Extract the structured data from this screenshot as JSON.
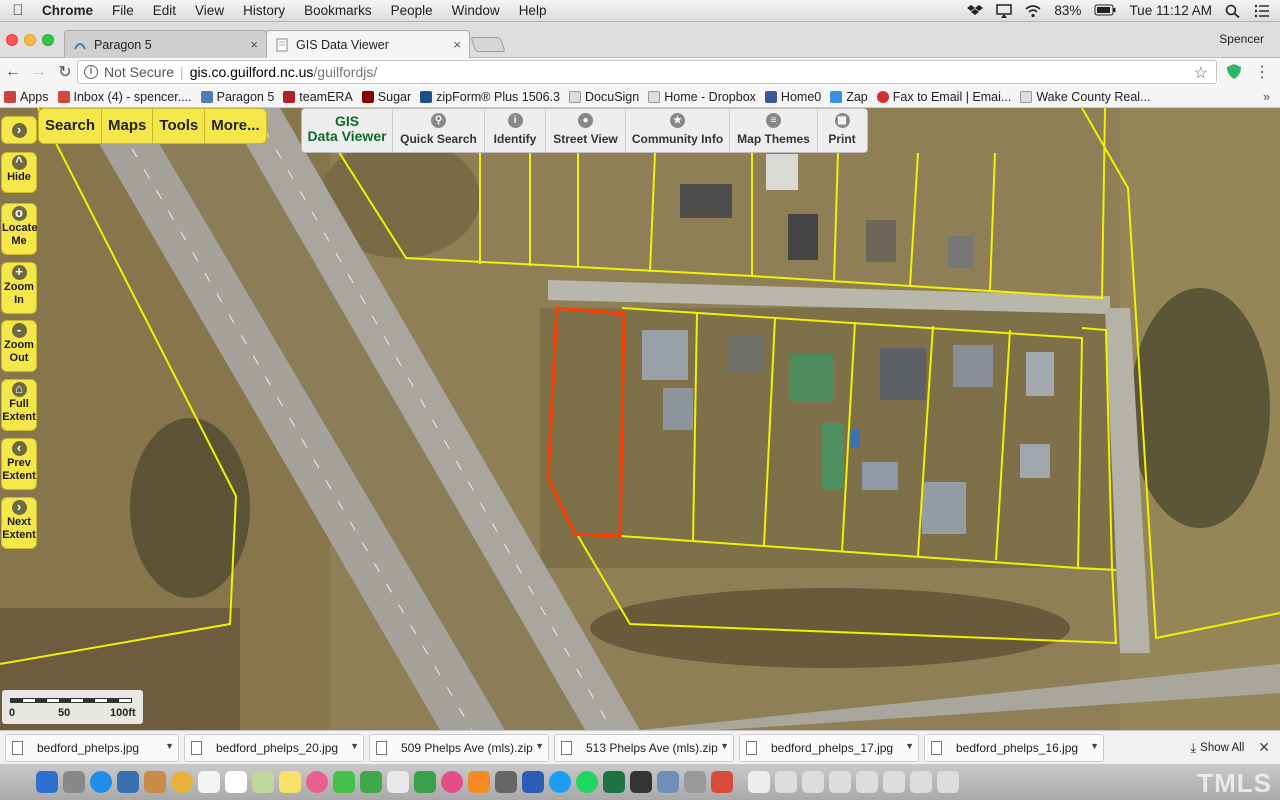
{
  "menubar": {
    "app": "Chrome",
    "menus": [
      "File",
      "Edit",
      "View",
      "History",
      "Bookmarks",
      "People",
      "Window",
      "Help"
    ],
    "battery": "83%",
    "clock": "Tue 11:12 AM"
  },
  "tabs": [
    {
      "title": "Paragon 5",
      "close": "×"
    },
    {
      "title": "GIS Data Viewer",
      "close": "×"
    }
  ],
  "profile": "Spencer",
  "address": {
    "security": "Not Secure",
    "separator": "|",
    "host": "gis.co.guilford.nc.us",
    "path": "/guilfordjs/"
  },
  "bookmarks": [
    {
      "label": "Apps",
      "color": "#d04040"
    },
    {
      "label": "Inbox (4) - spencer....",
      "color": "#d44638"
    },
    {
      "label": "Paragon 5",
      "color": "#4a7fb5"
    },
    {
      "label": "teamERA",
      "color": "#b22222"
    },
    {
      "label": "Sugar",
      "color": "#8b0000"
    },
    {
      "label": "zipForm® Plus 1506.3",
      "color": "#1a4f8a"
    },
    {
      "label": "DocuSign",
      "color": "#888888"
    },
    {
      "label": "Home - Dropbox",
      "color": "#1f6fd1"
    },
    {
      "label": "Home0",
      "color": "#3b5998"
    },
    {
      "label": "Zap",
      "color": "#3a8ee6"
    },
    {
      "label": "Fax to Email | Emai...",
      "color": "#d62e2e"
    },
    {
      "label": "Wake County Real...",
      "color": "#999999"
    }
  ],
  "bookmarks_more": "»",
  "map_controls": {
    "top": [
      "Search",
      "Maps",
      "Tools",
      "More..."
    ],
    "side": [
      {
        "label": "Hide",
        "icon": "^"
      },
      {
        "label": "Locate Me",
        "icon": "o"
      },
      {
        "label": "Zoom In",
        "icon": "+"
      },
      {
        "label": "Zoom Out",
        "icon": "-"
      },
      {
        "label": "Full Extent",
        "icon": "⌂"
      },
      {
        "label": "Prev Extent",
        "icon": "‹"
      },
      {
        "label": "Next Extent",
        "icon": "›"
      }
    ]
  },
  "gis_toolbar": {
    "logo_line1": "GIS",
    "logo_line2": "Data Viewer",
    "buttons": [
      "Quick Search",
      "Identify",
      "Street View",
      "Community Info",
      "Map Themes",
      "Print"
    ]
  },
  "scale": {
    "l0": "0",
    "l50": "50",
    "l100": "100ft"
  },
  "downloads": [
    "bedford_phelps.jpg",
    "bedford_phelps_20.jpg",
    "509 Phelps Ave (mls).zip",
    "513 Phelps Ave (mls).zip",
    "bedford_phelps_17.jpg",
    "bedford_phelps_16.jpg"
  ],
  "show_all": "Show All",
  "colors": {
    "parcel_line": "#f2f200",
    "selected_parcel": "#ff3b00",
    "control_yellow": "#f5e74a"
  },
  "watermark": "TMLS"
}
